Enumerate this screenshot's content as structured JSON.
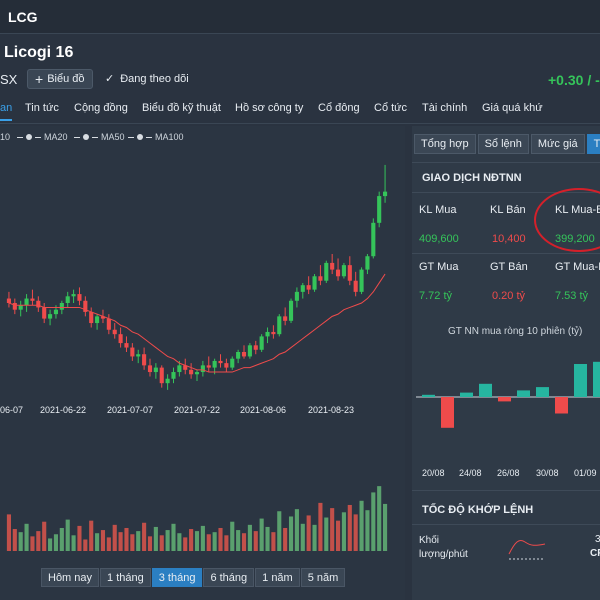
{
  "header": {
    "ticker": "LCG"
  },
  "company": {
    "name": "Licogi 16",
    "exchange": "SX",
    "chart_button": "Biểu đồ",
    "follow_label": "Đang theo dõi",
    "price_change": "+0.30 / -"
  },
  "tabs": [
    "an",
    "Tin tức",
    "Cộng đồng",
    "Biểu đồ kỹ thuật",
    "Hồ sơ công ty",
    "Cổ đông",
    "Cổ tức",
    "Tài chính",
    "Giá quá khứ"
  ],
  "legend": [
    "10",
    "MA20",
    "MA50",
    "MA100"
  ],
  "x_dates": [
    "06-07",
    "2021-06-22",
    "2021-07-07",
    "2021-07-22",
    "2021-08-06",
    "2021-08-23"
  ],
  "ranges": [
    "Hôm nay",
    "1 tháng",
    "3 tháng",
    "6 tháng",
    "1 năm",
    "5 năm"
  ],
  "active_range": "3 tháng",
  "right": {
    "subtabs": [
      "Tổng hợp",
      "Sổ lệnh",
      "Mức giá",
      "Thô"
    ],
    "section1": "GIAO DỊCH NĐTNN",
    "row1_labels": [
      "KL Mua",
      "KL Bán",
      "KL Mua-B"
    ],
    "row1_values": [
      "409,600",
      "10,400",
      "399,200"
    ],
    "row2_labels": [
      "GT Mua",
      "GT Bán",
      "GT Mua-B"
    ],
    "row2_values": [
      "7.72 tỷ",
      "0.20 tỷ",
      "7.53 tỷ"
    ],
    "nn_title": "GT NN mua ròng 10 phiên (tỷ)",
    "nn_dates": [
      "20/08",
      "24/08",
      "26/08",
      "30/08",
      "01/09"
    ],
    "section2": "TỐC ĐỘ KHỚP LỆNH",
    "speed_label_1": "Khối",
    "speed_label_2": "lượng/phút",
    "speed_right_1": "3",
    "speed_right_2": "CF"
  },
  "colors": {
    "up": "#35c45a",
    "down": "#ef4b4b",
    "accent": "#2b7fc2",
    "ma": "#ef4b4b",
    "annotation": "#d4202a"
  },
  "chart_data": {
    "type": "candlestick",
    "series": [
      {
        "name": "price",
        "ohlc": [
          [
            14.6,
            14.9,
            14.2,
            14.4
          ],
          [
            14.4,
            14.6,
            13.9,
            14.1
          ],
          [
            14.1,
            14.5,
            13.8,
            14.3
          ],
          [
            14.3,
            14.8,
            14.0,
            14.6
          ],
          [
            14.6,
            15.0,
            14.3,
            14.5
          ],
          [
            14.5,
            14.7,
            14.0,
            14.2
          ],
          [
            14.2,
            14.4,
            13.5,
            13.7
          ],
          [
            13.7,
            14.1,
            13.4,
            13.9
          ],
          [
            13.9,
            14.3,
            13.7,
            14.1
          ],
          [
            14.1,
            14.5,
            13.9,
            14.4
          ],
          [
            14.4,
            14.9,
            14.2,
            14.7
          ],
          [
            14.7,
            15.0,
            14.4,
            14.8
          ],
          [
            14.8,
            15.1,
            14.3,
            14.5
          ],
          [
            14.5,
            14.7,
            13.8,
            14.0
          ],
          [
            14.0,
            14.2,
            13.3,
            13.5
          ],
          [
            13.5,
            13.9,
            13.2,
            13.8
          ],
          [
            13.8,
            14.1,
            13.5,
            13.7
          ],
          [
            13.7,
            13.9,
            13.0,
            13.2
          ],
          [
            13.2,
            13.5,
            12.8,
            13.0
          ],
          [
            13.0,
            13.3,
            12.4,
            12.6
          ],
          [
            12.6,
            12.9,
            12.2,
            12.4
          ],
          [
            12.4,
            12.6,
            11.8,
            12.0
          ],
          [
            12.0,
            12.3,
            11.7,
            12.1
          ],
          [
            12.1,
            12.4,
            11.4,
            11.6
          ],
          [
            11.6,
            11.9,
            11.1,
            11.3
          ],
          [
            11.3,
            11.7,
            11.0,
            11.5
          ],
          [
            11.5,
            11.6,
            10.6,
            10.8
          ],
          [
            10.8,
            11.2,
            10.5,
            11.0
          ],
          [
            11.0,
            11.5,
            10.8,
            11.3
          ],
          [
            11.3,
            11.8,
            11.1,
            11.6
          ],
          [
            11.6,
            11.9,
            11.2,
            11.4
          ],
          [
            11.4,
            11.7,
            11.0,
            11.2
          ],
          [
            11.2,
            11.4,
            10.9,
            11.3
          ],
          [
            11.3,
            11.8,
            11.1,
            11.6
          ],
          [
            11.6,
            12.0,
            11.3,
            11.5
          ],
          [
            11.5,
            11.9,
            11.2,
            11.8
          ],
          [
            11.8,
            12.1,
            11.5,
            11.7
          ],
          [
            11.7,
            11.9,
            11.3,
            11.5
          ],
          [
            11.5,
            12.0,
            11.4,
            11.9
          ],
          [
            11.9,
            12.3,
            11.7,
            12.2
          ],
          [
            12.2,
            12.5,
            11.9,
            12.0
          ],
          [
            12.0,
            12.6,
            11.9,
            12.5
          ],
          [
            12.5,
            12.7,
            12.1,
            12.3
          ],
          [
            12.3,
            13.0,
            12.2,
            12.9
          ],
          [
            12.9,
            13.3,
            12.6,
            13.1
          ],
          [
            13.1,
            13.4,
            12.8,
            13.0
          ],
          [
            13.0,
            13.9,
            12.9,
            13.8
          ],
          [
            13.8,
            14.2,
            13.4,
            13.6
          ],
          [
            13.6,
            14.6,
            13.5,
            14.5
          ],
          [
            14.5,
            15.1,
            14.2,
            14.9
          ],
          [
            14.9,
            15.3,
            14.6,
            15.2
          ],
          [
            15.2,
            15.6,
            14.8,
            15.0
          ],
          [
            15.0,
            15.7,
            14.9,
            15.6
          ],
          [
            15.6,
            16.1,
            15.2,
            15.4
          ],
          [
            15.4,
            16.3,
            15.3,
            16.2
          ],
          [
            16.2,
            16.6,
            15.7,
            15.9
          ],
          [
            15.9,
            16.4,
            15.4,
            15.6
          ],
          [
            15.6,
            16.2,
            15.5,
            16.1
          ],
          [
            16.1,
            16.5,
            15.2,
            15.4
          ],
          [
            15.4,
            15.8,
            14.7,
            14.9
          ],
          [
            14.9,
            16.0,
            14.8,
            15.9
          ],
          [
            15.9,
            16.6,
            15.7,
            16.5
          ],
          [
            16.5,
            18.2,
            16.4,
            18.0
          ],
          [
            18.0,
            19.4,
            17.8,
            19.2
          ],
          [
            19.2,
            20.6,
            18.9,
            19.4
          ]
        ]
      },
      {
        "name": "MA",
        "values": [
          14.4,
          14.3,
          14.3,
          14.3,
          14.3,
          14.3,
          14.2,
          14.2,
          14.2,
          14.2,
          14.2,
          14.2,
          14.2,
          14.1,
          14.0,
          13.9,
          13.8,
          13.7,
          13.6,
          13.4,
          13.3,
          13.1,
          13.0,
          12.8,
          12.6,
          12.4,
          12.2,
          12.0,
          11.9,
          11.7,
          11.6,
          11.5,
          11.4,
          11.4,
          11.3,
          11.3,
          11.3,
          11.3,
          11.3,
          11.4,
          11.5,
          11.5,
          11.6,
          11.7,
          11.8,
          11.9,
          12.1,
          12.2,
          12.4,
          12.6,
          12.8,
          13.0,
          13.2,
          13.4,
          13.6,
          13.8,
          13.9,
          14.1,
          14.2,
          14.3,
          14.4,
          14.6,
          14.9,
          15.3,
          15.7
        ]
      },
      {
        "name": "volume",
        "values": [
          3.5,
          2.1,
          1.8,
          2.6,
          1.4,
          1.9,
          2.8,
          1.2,
          1.6,
          2.2,
          3.0,
          1.5,
          2.4,
          1.1,
          2.9,
          1.7,
          2.0,
          1.3,
          2.5,
          1.8,
          2.2,
          1.6,
          1.9,
          2.7,
          1.4,
          2.3,
          1.5,
          2.0,
          2.6,
          1.7,
          1.3,
          2.1,
          1.9,
          2.4,
          1.6,
          1.8,
          2.2,
          1.5,
          2.8,
          2.0,
          1.7,
          2.5,
          1.9,
          3.1,
          2.3,
          1.8,
          3.8,
          2.2,
          3.3,
          4.0,
          2.6,
          3.4,
          2.5,
          4.6,
          3.2,
          4.1,
          2.9,
          3.7,
          4.4,
          3.5,
          4.8,
          3.9,
          5.6,
          6.2,
          4.5
        ]
      }
    ],
    "nn_net": {
      "dates": [
        "20/08",
        "24/08",
        "26/08",
        "30/08",
        "01/09"
      ],
      "values": [
        0.2,
        -2.8,
        0.4,
        1.2,
        -0.4,
        0.6,
        0.9,
        -1.5,
        3.0,
        3.2
      ]
    }
  }
}
